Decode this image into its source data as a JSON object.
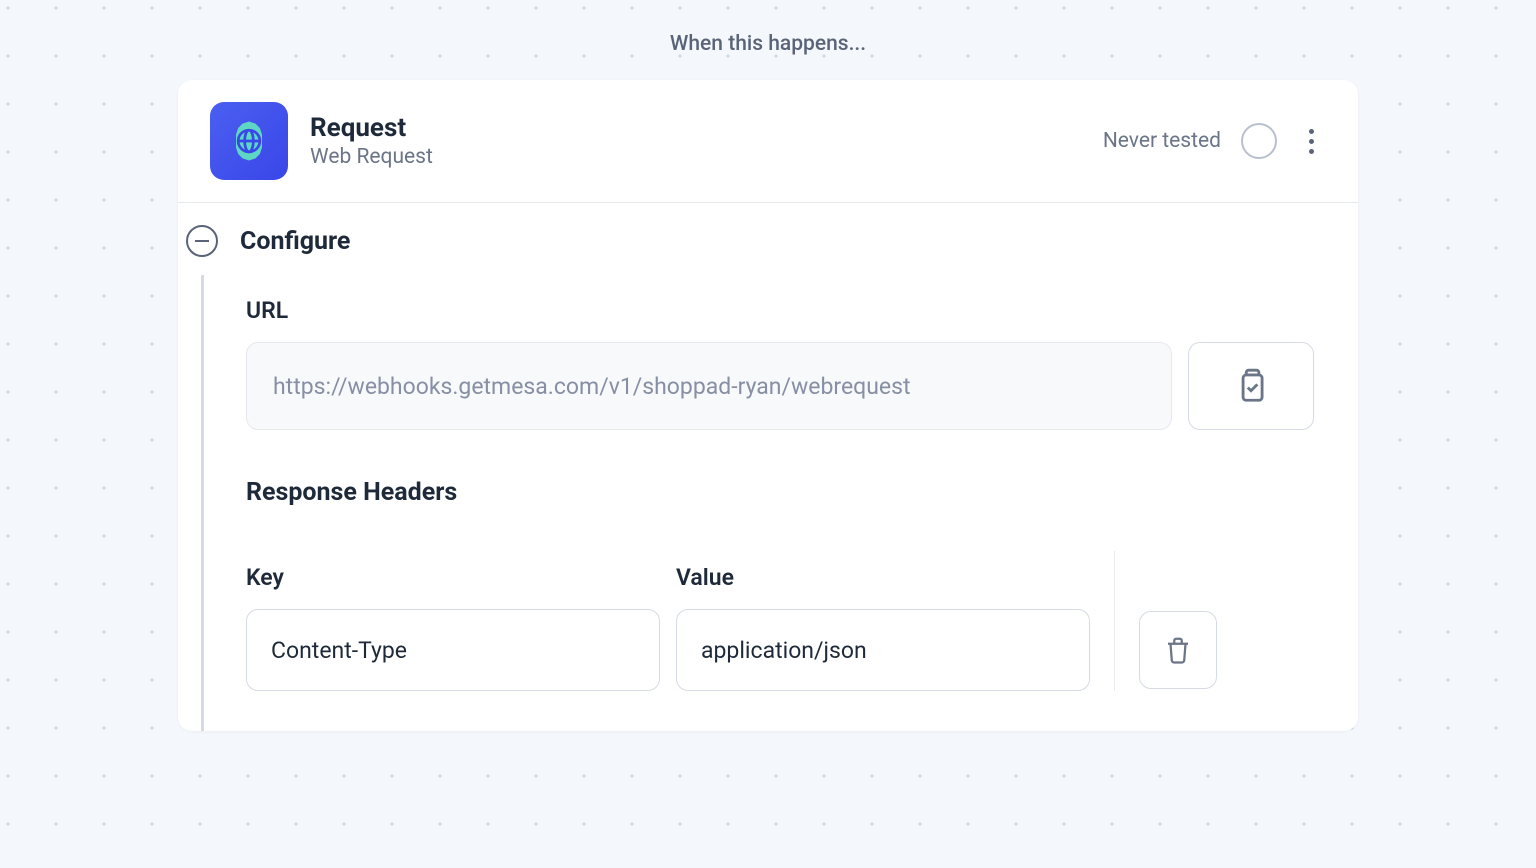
{
  "trigger_label": "When this happens...",
  "card": {
    "title": "Request",
    "subtitle": "Web Request",
    "status_text": "Never tested"
  },
  "configure": {
    "title": "Configure",
    "url": {
      "label": "URL",
      "value": "https://webhooks.getmesa.com/v1/shoppad-ryan/webrequest"
    },
    "response_headers": {
      "title": "Response Headers",
      "key_label": "Key",
      "value_label": "Value",
      "rows": [
        {
          "key": "Content-Type",
          "value": "application/json"
        }
      ]
    }
  }
}
